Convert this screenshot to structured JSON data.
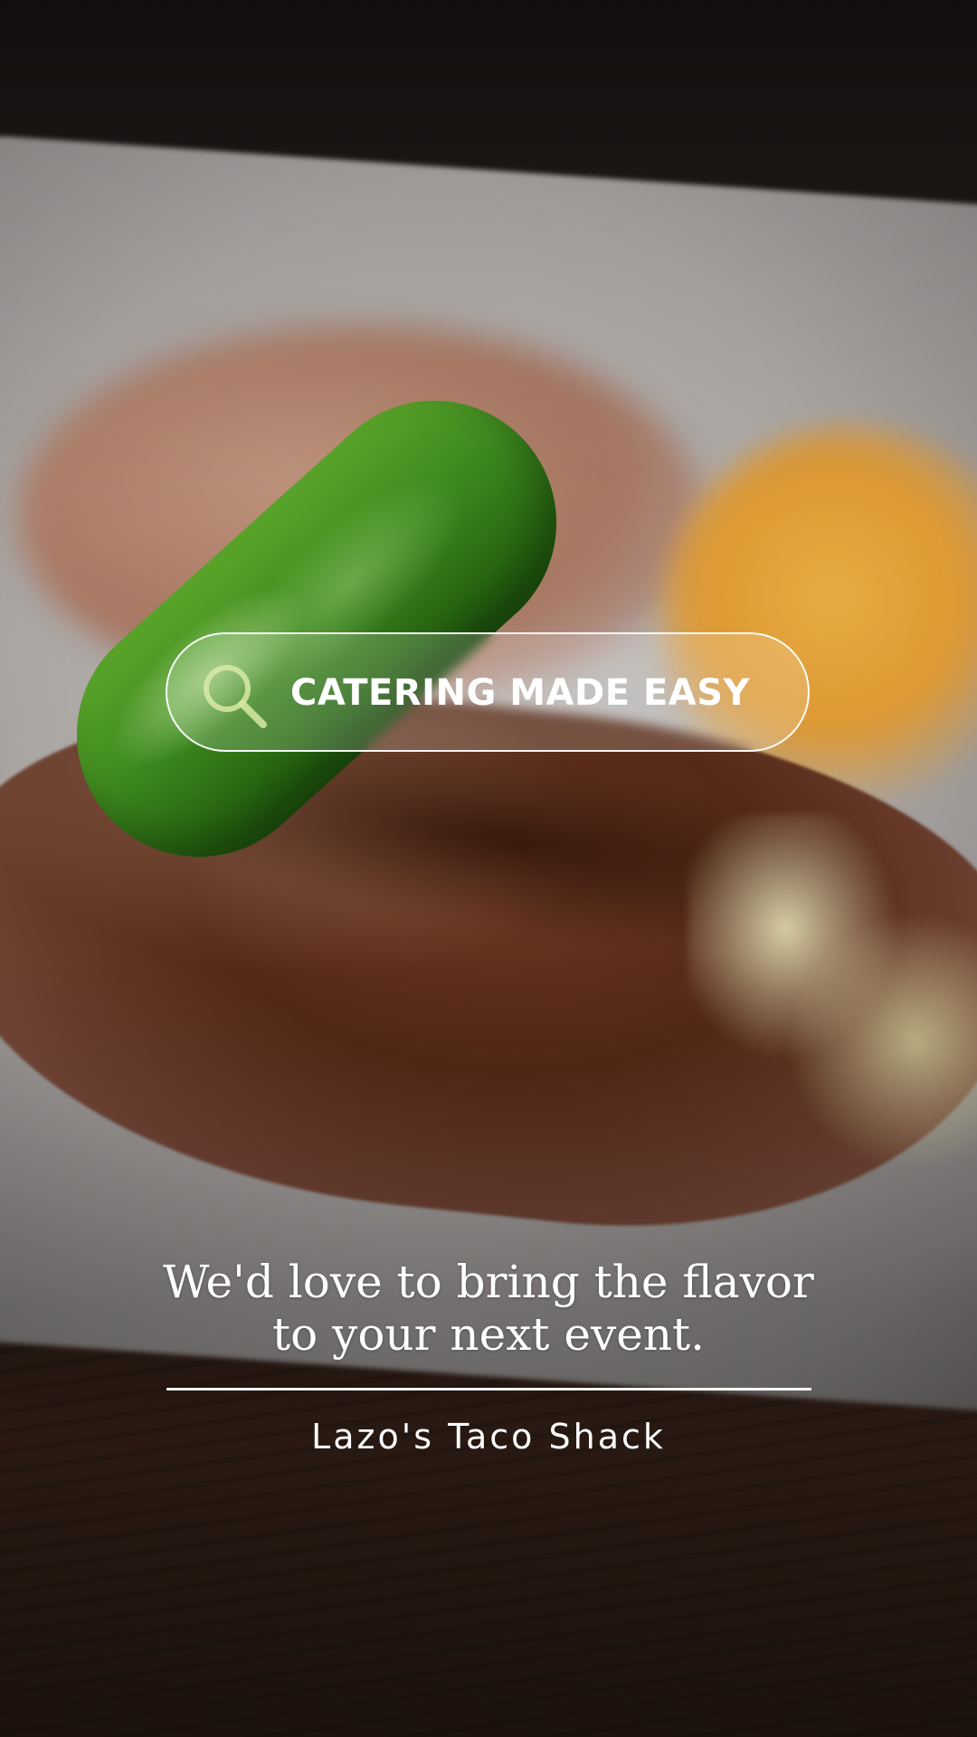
{
  "search": {
    "label": "CATERING MADE EASY",
    "icon": "search-icon"
  },
  "tagline": {
    "line1": "We'd love to bring the flavor",
    "line2": "to your next event."
  },
  "brand": {
    "name": "Lazo's Taco Shack"
  },
  "colors": {
    "text": "#ffffff",
    "pill_border": "#ffffff",
    "icon_tint": "#d9e9a8"
  }
}
